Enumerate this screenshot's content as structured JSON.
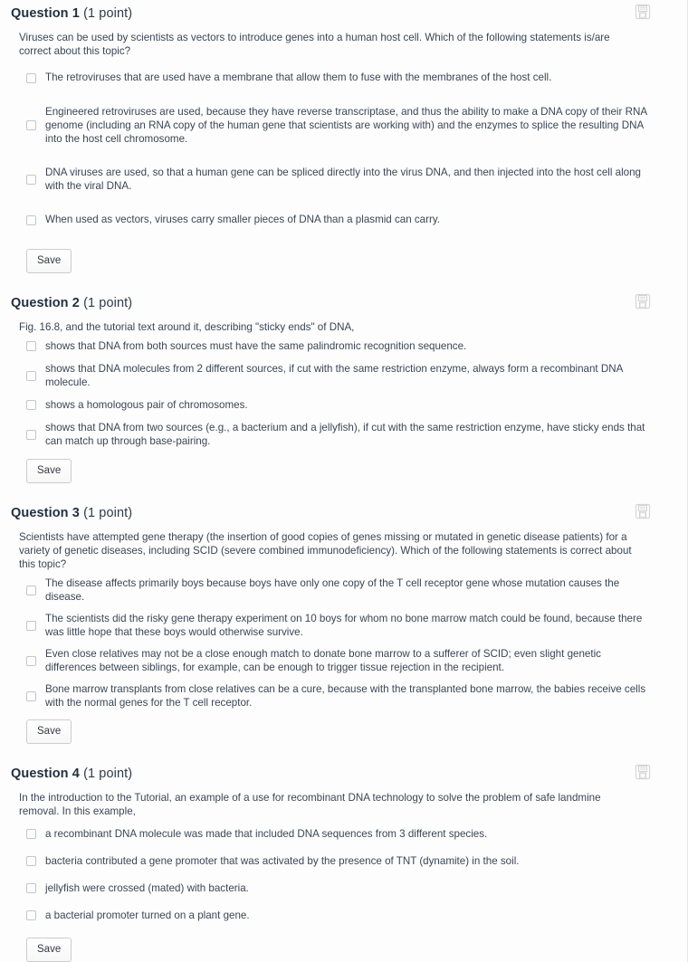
{
  "common": {
    "save_button_label": "Save",
    "save_icon_name": "floppy-disk-save-icon",
    "points_label": "(1 point)",
    "accent_text_color": "#3a4654",
    "title_color": "#22303f",
    "background_color": "#fbfbfb",
    "checkbox_border_color": "#c2c6cc"
  },
  "questions": [
    {
      "title": "Question 1",
      "points": "(1 point)",
      "prompt": "Viruses can be used by scientists as vectors to introduce genes into a human host cell. Which of the following statements is/are correct about this topic?",
      "options": [
        "The retroviruses that are used have a membrane that allow them to fuse with the membranes of the host cell.",
        "Engineered retroviruses are used, because they have reverse transcriptase, and thus the ability to make a DNA copy of their RNA genome (including an RNA copy of the human gene that scientists are working with) and the enzymes to splice the resulting DNA into the host cell chromosome.",
        "DNA viruses are used, so that a human gene can be spliced directly into the virus DNA, and then injected into the host cell along with the viral DNA.",
        "When used as vectors, viruses carry smaller pieces of DNA than a plasmid can carry."
      ],
      "save_label": "Save"
    },
    {
      "title": "Question 2",
      "points": "(1 point)",
      "prompt": "Fig. 16.8, and the tutorial text around it, describing \"sticky ends\" of DNA,",
      "options": [
        "shows that DNA from both sources must have the same palindromic recognition sequence.",
        "shows that DNA molecules from 2 different sources, if cut with the same restriction enzyme, always form a recombinant DNA molecule.",
        "shows a homologous pair of chromosomes.",
        "shows that DNA from two sources (e.g., a bacterium and a jellyfish), if cut with the same restriction enzyme, have sticky ends that can match up through base-pairing."
      ],
      "save_label": "Save"
    },
    {
      "title": "Question 3",
      "points": "(1 point)",
      "prompt": "Scientists have attempted gene therapy (the insertion of good copies of genes missing or mutated in genetic disease patients) for a variety of genetic diseases, including SCID (severe combined immunodeficiency). Which of the following statements is correct about this topic?",
      "options": [
        "The disease affects primarily boys because boys have only one copy of the T cell receptor gene whose mutation causes the disease.",
        "The scientists did the risky gene therapy experiment on 10 boys for whom no bone marrow match could be found, because there was little hope that these boys would otherwise survive.",
        "Even close relatives may not be a close enough match to donate bone marrow to a sufferer of SCID; even slight genetic differences between siblings, for example, can be enough to trigger tissue rejection in the recipient.",
        "Bone marrow transplants from close relatives can be a cure, because with the transplanted bone marrow, the babies receive cells with the normal genes for the T cell receptor."
      ],
      "save_label": "Save"
    },
    {
      "title": "Question 4",
      "points": "(1 point)",
      "prompt": "In the introduction to the Tutorial, an example of a use for recombinant DNA technology to solve the problem of safe landmine removal. In this example,",
      "options": [
        "a recombinant DNA molecule was made that included DNA sequences from 3 different species.",
        "bacteria contributed a gene promoter that was activated by the presence of TNT (dynamite) in the soil.",
        "jellyfish were crossed (mated) with bacteria.",
        "a bacterial promoter turned on a plant gene."
      ],
      "save_label": "Save"
    }
  ]
}
